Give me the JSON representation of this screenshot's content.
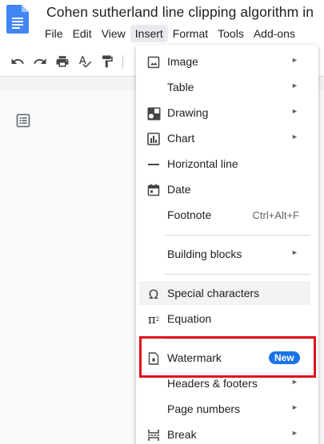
{
  "document": {
    "title": "Cohen sutherland line clipping algorithm in",
    "app_icon": "google-docs-icon"
  },
  "menubar": {
    "items": [
      "File",
      "Edit",
      "View",
      "Insert",
      "Format",
      "Tools",
      "Add-ons"
    ],
    "active": "Insert"
  },
  "toolbar": {
    "buttons": [
      "undo-icon",
      "redo-icon",
      "print-icon",
      "spellcheck-icon",
      "paint-format-icon"
    ]
  },
  "insert_menu": {
    "items": [
      {
        "label": "Image",
        "icon": "image-icon",
        "submenu": true,
        "arrow": "►"
      },
      {
        "label": "Table",
        "icon": "",
        "submenu": true,
        "arrow": "►"
      },
      {
        "label": "Drawing",
        "icon": "drawing-icon",
        "submenu": true,
        "arrow": "►"
      },
      {
        "label": "Chart",
        "icon": "chart-icon",
        "submenu": true,
        "arrow": "►"
      },
      {
        "label": "Horizontal line",
        "icon": "horizontal-line-icon",
        "submenu": false
      },
      {
        "label": "Date",
        "icon": "calendar-icon",
        "submenu": false
      },
      {
        "label": "Footnote",
        "icon": "",
        "shortcut": "Ctrl+Alt+F"
      },
      {
        "label": "Building blocks",
        "icon": "",
        "submenu": true,
        "arrow": "►"
      },
      {
        "label": "Special characters",
        "icon": "omega-icon",
        "submenu": false
      },
      {
        "label": "Equation",
        "icon": "pi-icon",
        "submenu": false
      },
      {
        "label": "Watermark",
        "icon": "watermark-icon",
        "badge": "New"
      },
      {
        "label": "Headers & footers",
        "icon": "",
        "submenu": true,
        "arrow": "►"
      },
      {
        "label": "Page numbers",
        "icon": "",
        "submenu": true,
        "arrow": "►"
      },
      {
        "label": "Break",
        "icon": "break-icon",
        "submenu": true,
        "arrow": "►"
      }
    ],
    "hovered": "Special characters",
    "highlighted": "Watermark"
  },
  "colors": {
    "accent": "#1a73e8",
    "highlight_border": "#e0121b",
    "docs_blue": "#4285f4",
    "menu_hover": "#f1f3f4"
  }
}
